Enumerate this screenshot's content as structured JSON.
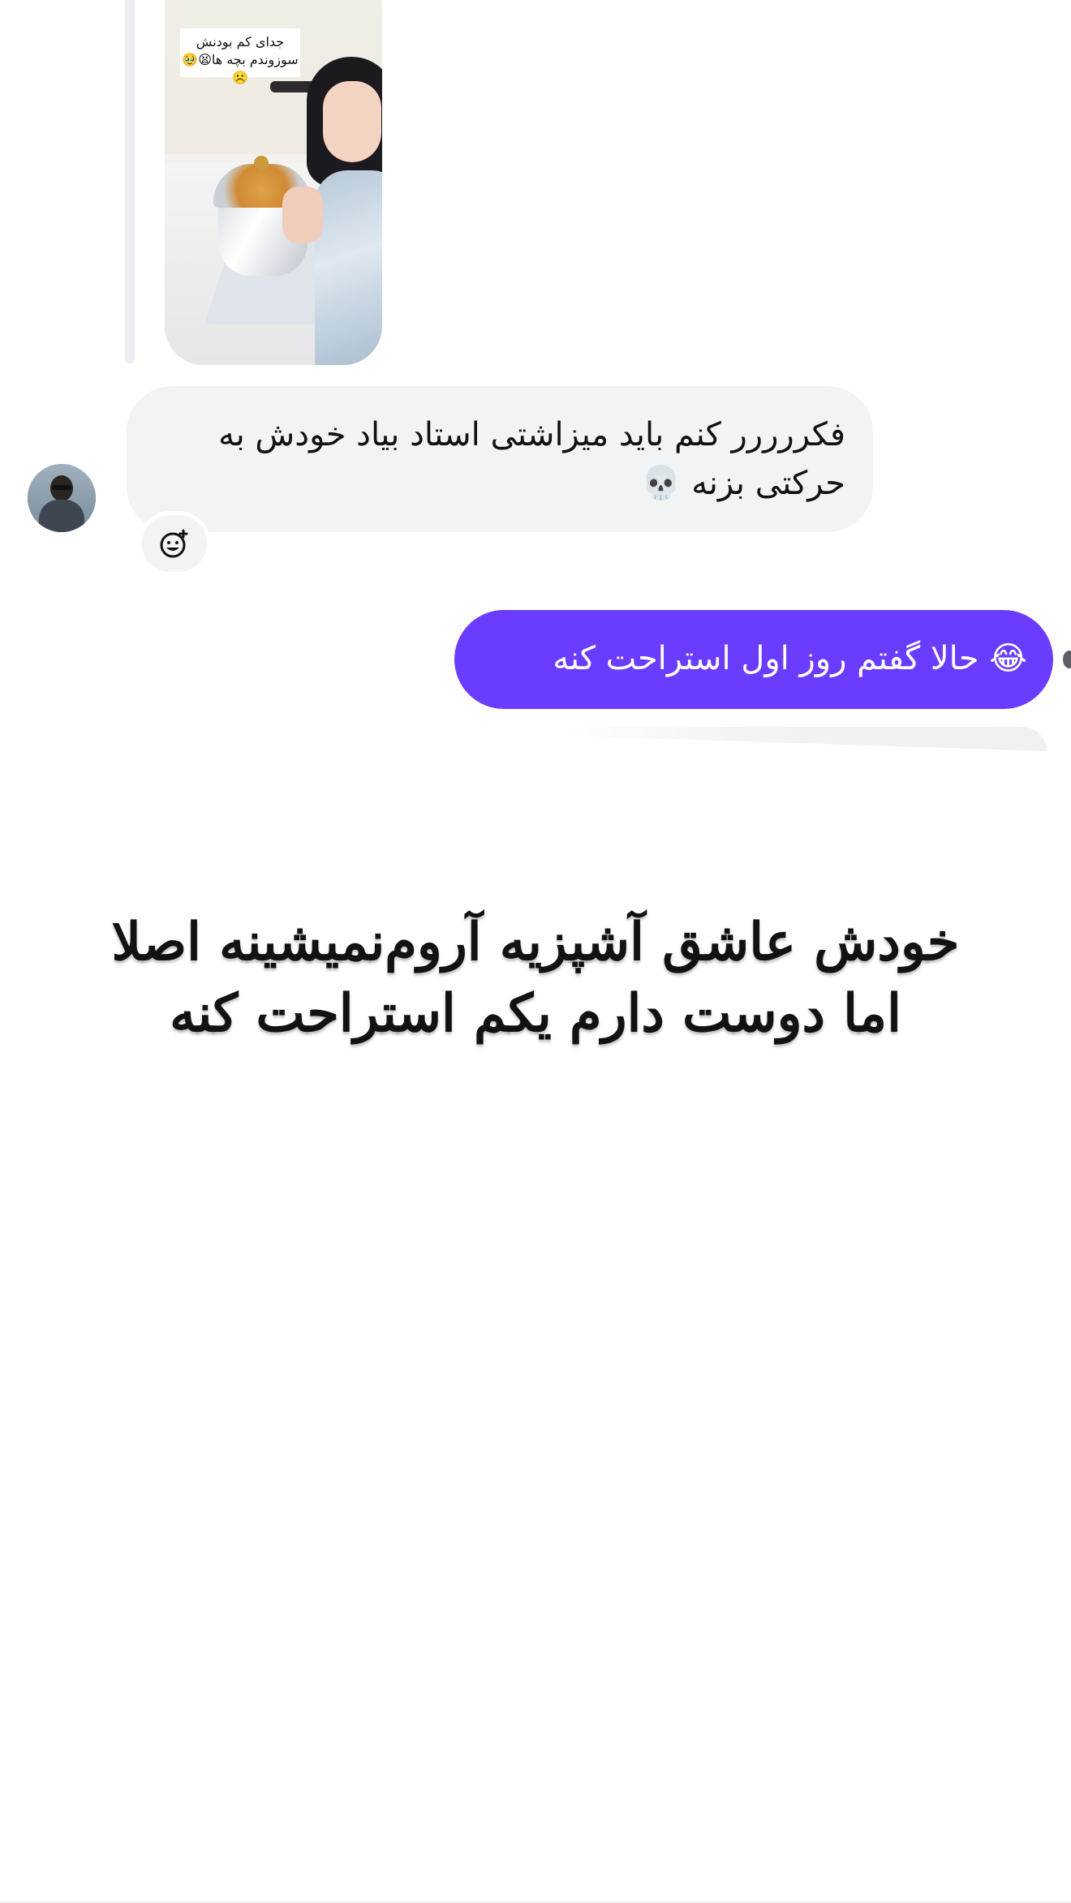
{
  "story_reply": {
    "caption_line1": "جدای کم بودنش",
    "caption_line2": "سوزوندم بچه ها😫🥹☹️"
  },
  "incoming_message": {
    "text": "فکررررر کنم باید میزاشتی استاد بیاد خودش به حرکتی بزنه 💀"
  },
  "reaction_button": {
    "icon": "add-reaction-icon"
  },
  "outgoing_message": {
    "text": "😂 حالا گفتم روز اول استراحت کنه"
  },
  "overlay_caption": {
    "line1": "خودش عاشق آشپزیه آروم‌نمیشینه اصلا",
    "line2": "اما دوست دارم یکم استراحت کنه"
  },
  "colors": {
    "outgoing_bubble": "#6a3cff",
    "incoming_bubble": "#f2f3f5",
    "background": "#ffffff"
  }
}
